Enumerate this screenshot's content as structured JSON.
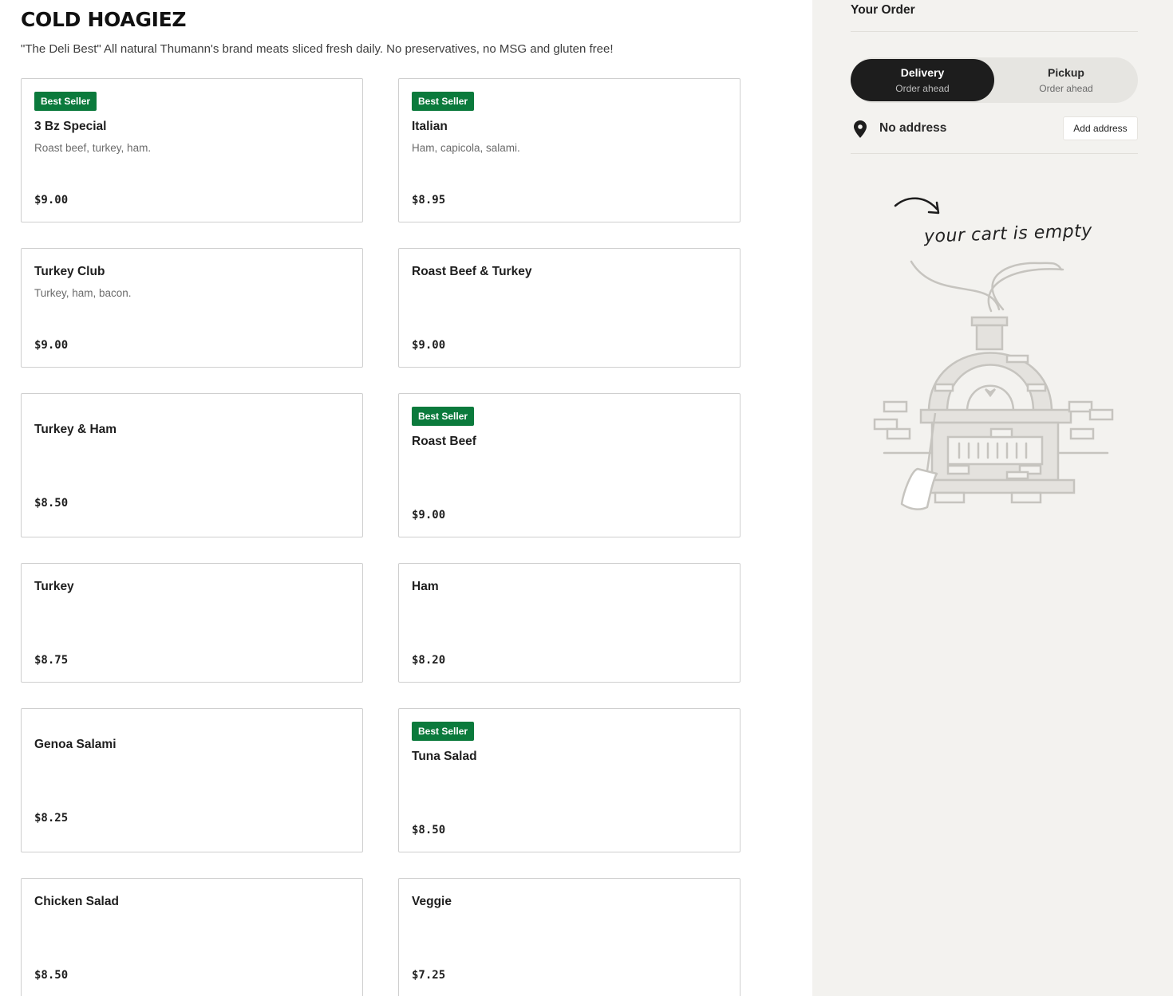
{
  "section": {
    "title": "COLD HOAGIEZ",
    "description": "\"The Deli Best\" All natural Thumann's brand meats sliced fresh daily. No preservatives, no MSG and gluten free!"
  },
  "items": [
    {
      "name": "3 Bz Special",
      "description": "Roast beef, turkey, ham.",
      "price": "$9.00",
      "badge": "Best Seller"
    },
    {
      "name": "Italian",
      "description": "Ham, capicola, salami.",
      "price": "$8.95",
      "badge": "Best Seller"
    },
    {
      "name": "Turkey Club",
      "description": "Turkey, ham, bacon.",
      "price": "$9.00",
      "badge": ""
    },
    {
      "name": "Roast Beef & Turkey",
      "description": "",
      "price": "$9.00",
      "badge": ""
    },
    {
      "name": "Turkey & Ham",
      "description": "",
      "price": "$8.50",
      "badge": ""
    },
    {
      "name": "Roast Beef",
      "description": "",
      "price": "$9.00",
      "badge": "Best Seller"
    },
    {
      "name": "Turkey",
      "description": "",
      "price": "$8.75",
      "badge": ""
    },
    {
      "name": "Ham",
      "description": "",
      "price": "$8.20",
      "badge": ""
    },
    {
      "name": "Genoa Salami",
      "description": "",
      "price": "$8.25",
      "badge": ""
    },
    {
      "name": "Tuna Salad",
      "description": "",
      "price": "$8.50",
      "badge": "Best Seller"
    },
    {
      "name": "Chicken Salad",
      "description": "",
      "price": "$8.50",
      "badge": ""
    },
    {
      "name": "Veggie",
      "description": "",
      "price": "$7.25",
      "badge": ""
    }
  ],
  "order": {
    "title": "Your Order",
    "delivery_label": "Delivery",
    "delivery_sub": "Order ahead",
    "pickup_label": "Pickup",
    "pickup_sub": "Order ahead",
    "selected_mode": "Delivery",
    "address_status": "No address",
    "add_address_label": "Add address",
    "empty_cart_text": "your cart is empty"
  },
  "colors": {
    "badge": "#0b7a3c",
    "sidebar_bg": "#f3f2ef",
    "toggle_active": "#1d1d1d"
  },
  "icons": {
    "location": "map-pin-icon",
    "empty_cart": "pizza-oven-illustration"
  }
}
